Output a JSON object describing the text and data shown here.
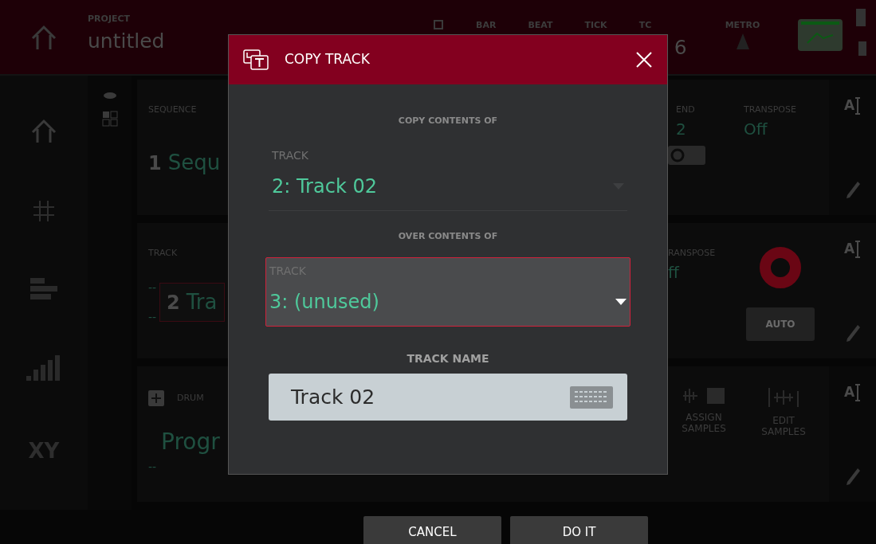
{
  "header": {
    "project_label": "PROJECT",
    "project_name": "untitled",
    "counters": [
      {
        "label": "BAR"
      },
      {
        "label": "BEAT"
      },
      {
        "label": "TICK"
      },
      {
        "label": "TC"
      }
    ],
    "tc_value": "6",
    "metro_label": "METRO"
  },
  "sidebar": {
    "xy_text": "XY"
  },
  "sequence_card": {
    "label": "SEQUENCE",
    "number": "1",
    "name": "Sequ",
    "end_label": "END",
    "end_value": "2",
    "loop_toggle_on": false,
    "transpose_label": "TRANSPOSE",
    "transpose_value": "Off",
    "rename_letter": "A"
  },
  "track_card": {
    "label": "TRACK",
    "dash_top": "--",
    "number": "2",
    "name": "Tra",
    "dash_bottom": "--",
    "transpose_label": "RANSPOSE",
    "transpose_value": "ff",
    "auto_button": "AUTO",
    "rename_letter": "A"
  },
  "program_card": {
    "type_label": "DRUM",
    "name": "Progr",
    "dash": "--",
    "actions": [
      "ASSIGN SAMPLES",
      "EDIT SAMPLES"
    ],
    "rename_letter": "A"
  },
  "dialog": {
    "title": "COPY TRACK",
    "sections": [
      {
        "heading": "COPY CONTENTS OF",
        "field_label": "TRACK",
        "value": "2: Track 02",
        "selected": false
      },
      {
        "heading": "OVER CONTENTS OF",
        "field_label": "TRACK",
        "value": "3: (unused)",
        "selected": true
      }
    ],
    "name_label": "TRACK NAME",
    "name_value": "Track 02"
  },
  "footer": {
    "buttons": [
      "CANCEL",
      "DO IT"
    ]
  }
}
